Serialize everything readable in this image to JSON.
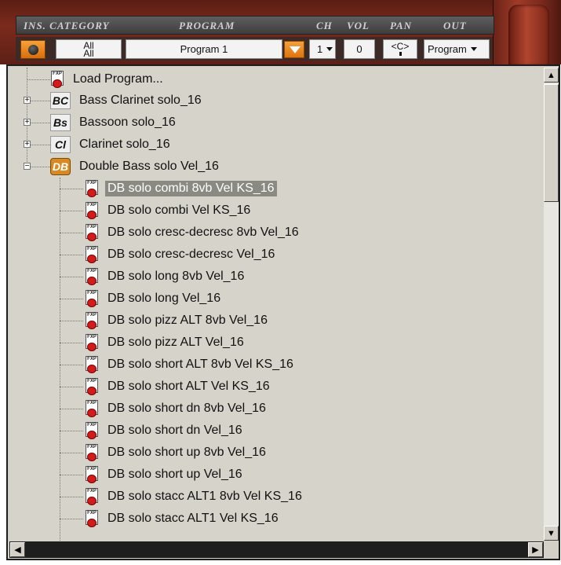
{
  "header": {
    "labels": {
      "ins_category": "INS. CATEGORY",
      "program": "PROGRAM",
      "ch": "CH",
      "vol": "VOL",
      "pan": "PAN",
      "out": "OUT"
    },
    "category_value_line1": "All",
    "category_value_line2": "All",
    "program_value": "Program 1",
    "channel_value": "1",
    "volume_value": "0",
    "pan_value": "<C>",
    "out_value": "Program"
  },
  "tree": {
    "load_program": "Load Program...",
    "categories": [
      {
        "badge": "BC",
        "label": "Bass Clarinet solo_16",
        "expanded": false
      },
      {
        "badge": "Bs",
        "label": "Bassoon solo_16",
        "expanded": false
      },
      {
        "badge": "Cl",
        "label": "Clarinet solo_16",
        "expanded": false
      },
      {
        "badge": "DB",
        "label": "Double Bass solo Vel_16",
        "expanded": true
      }
    ],
    "programs": [
      "DB solo combi 8vb Vel KS_16",
      "DB solo combi Vel KS_16",
      "DB solo cresc-decresc 8vb Vel_16",
      "DB solo cresc-decresc Vel_16",
      "DB solo long 8vb Vel_16",
      "DB solo long Vel_16",
      "DB solo pizz ALT 8vb Vel_16",
      "DB solo pizz ALT Vel_16",
      "DB solo short ALT 8vb Vel KS_16",
      "DB solo short ALT Vel KS_16",
      "DB solo short dn 8vb Vel_16",
      "DB solo short dn Vel_16",
      "DB solo short up 8vb Vel_16",
      "DB solo short up Vel_16",
      "DB solo stacc ALT1 8vb Vel KS_16",
      "DB solo stacc ALT1 Vel KS_16"
    ],
    "selected_program": "DB solo combi 8vb Vel KS_16",
    "file_icon_text": "FXP"
  },
  "icons": {
    "collapse": "minus-icon",
    "expand": "plus-icon",
    "scroll_up": "arrow-up-icon",
    "scroll_down": "arrow-down-icon",
    "scroll_left": "arrow-left-icon",
    "scroll_right": "arrow-right-icon"
  },
  "colors": {
    "accent_orange": "#e0780f",
    "selection": "#8a8a82",
    "list_background": "#d6d3ca"
  }
}
